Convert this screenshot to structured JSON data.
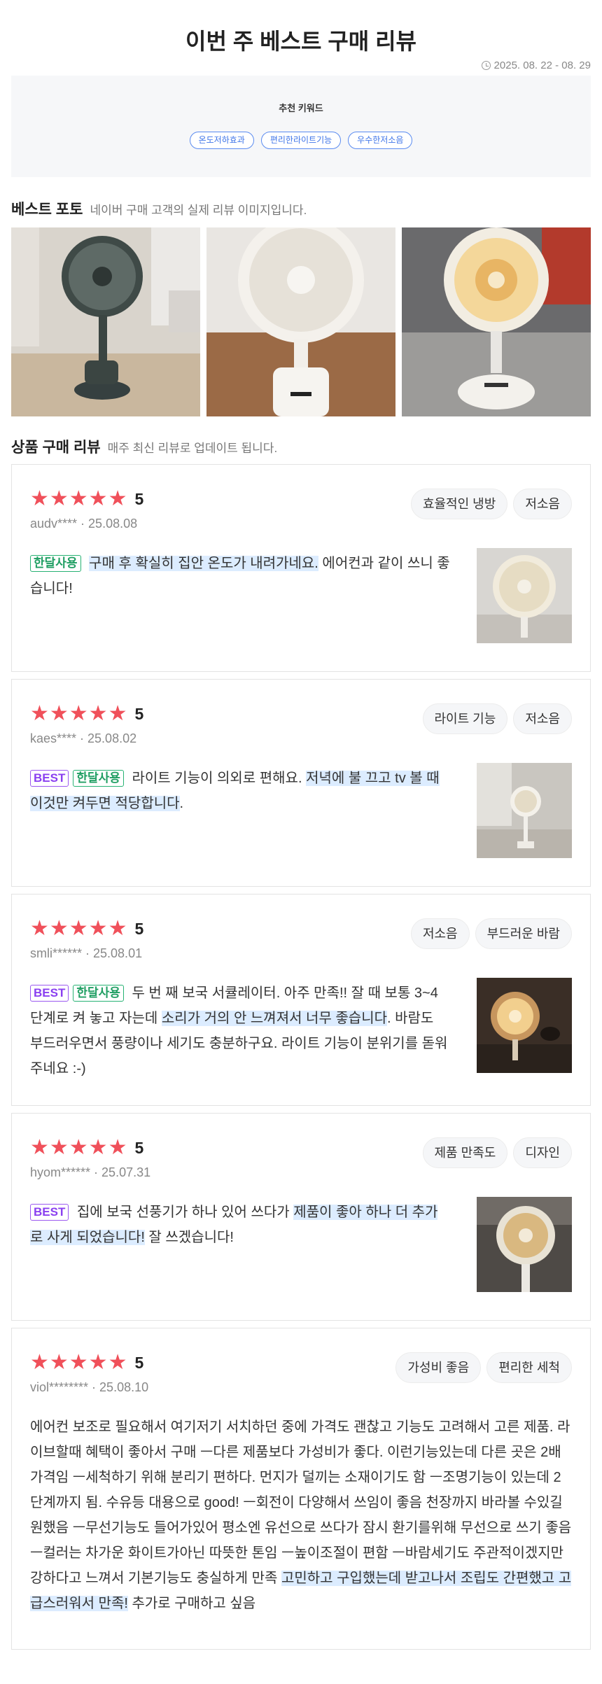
{
  "header": {
    "title": "이번 주 베스트 구매 리뷰",
    "period": "2025. 08. 22 - 08. 29"
  },
  "keywords": {
    "title": "추천 키워드",
    "tags": [
      "온도저하효과",
      "편리한라이트기능",
      "우수한저소음"
    ]
  },
  "best_photos": {
    "title": "베스트 포토",
    "subtitle": "네이버 구매 고객의 실제 리뷰 이미지입니다."
  },
  "reviews_section": {
    "title": "상품 구매 리뷰",
    "subtitle": "매주 최신 리뷰로 업데이트 됩니다."
  },
  "badges": {
    "best": "BEST",
    "month": "한달사용"
  },
  "reviews": [
    {
      "rating": "5",
      "stars": "★★★★★",
      "meta": "audv**** · 25.08.08",
      "tags": [
        "효율적인 냉방",
        "저소음"
      ],
      "text_hl": "구매 후 확실히 집안 온도가 내려가네요.",
      "text_rest": " 에어컨과 같이 쓰니 좋습니다!"
    },
    {
      "rating": "5",
      "stars": "★★★★★",
      "meta": "kaes**** · 25.08.02",
      "tags": [
        "라이트 기능",
        "저소음"
      ],
      "text_pre": "라이트 기능이 의외로 편해요. ",
      "text_hl": "저녁에 불 끄고 tv 볼 때 이것만 켜두면 적당합니다",
      "text_rest": "."
    },
    {
      "rating": "5",
      "stars": "★★★★★",
      "meta": "smli****** · 25.08.01",
      "tags": [
        "저소음",
        "부드러운 바람"
      ],
      "text_pre": "두 번 째 보국 서큘레이터. 아주 만족!! 잘 때 보통 3~4단계로 켜 놓고 자는데 ",
      "text_hl": "소리가 거의 안 느껴져서 너무 좋습니다",
      "text_rest": ". 바람도 부드러우면서 풍량이나 세기도 충분하구요. 라이트 기능이 분위기를 돋워주네요 :-)"
    },
    {
      "rating": "5",
      "stars": "★★★★★",
      "meta": "hyom****** · 25.07.31",
      "tags": [
        "제품 만족도",
        "디자인"
      ],
      "text_pre": "집에 보국 선풍기가 하나 있어 쓰다가 ",
      "text_hl": "제품이 좋아 하나 더 추가로 사게 되었습니다!",
      "text_rest": " 잘 쓰겠습니다!"
    },
    {
      "rating": "5",
      "stars": "★★★★★",
      "meta": "viol******** · 25.08.10",
      "tags": [
        "가성비 좋음",
        "편리한 세척"
      ],
      "text_pre": "에어컨 보조로 필요해서 여기저기 서치하던 중에 가격도 괜찮고 기능도 고려해서 고른 제품. 라이브할때 혜택이 좋아서 구매 ㅡ다른 제품보다 가성비가 좋다. 이런기능있는데 다른 곳은 2배 가격임 ㅡ세척하기 위해 분리기 편하다. 먼지가 덜끼는 소재이기도 함 ㅡ조명기능이 있는데 2단계까지 됨. 수유등 대용으로 good! ㅡ회전이 다양해서 쓰임이 좋음 천장까지 바라볼 수있길 원했음 ㅡ무선기능도 들어가있어 평소엔 유선으로 쓰다가 잠시 환기를위해 무선으로 쓰기 좋음 ㅡ컬러는 차가운 화이트가아닌 따뜻한 톤임 ㅡ높이조절이 편함 ㅡ바람세기도 주관적이겠지만 강하다고 느껴서 기본기능도 충실하게 만족 ",
      "text_hl": "고민하고 구입했는데 받고나서 조립도 간편했고 고급스러워서 만족!",
      "text_rest": " 추가로 구매하고 싶음"
    }
  ]
}
